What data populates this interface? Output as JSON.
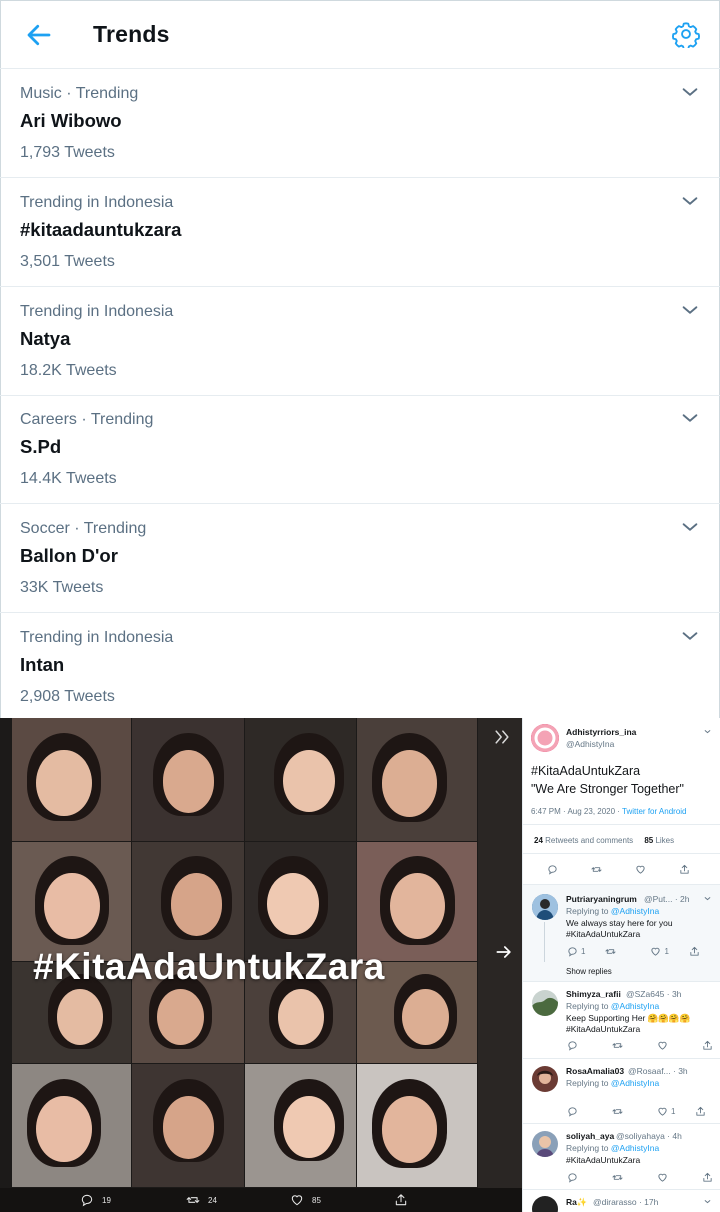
{
  "header": {
    "title": "Trends",
    "back_icon": "arrow-left-icon",
    "settings_icon": "gear-icon",
    "accent_color": "#1da1f2"
  },
  "trends": [
    {
      "context": "Music · Trending",
      "name": "Ari Wibowo",
      "count": "1,793 Tweets"
    },
    {
      "context": "Trending in Indonesia",
      "name": "#kitaadauntukzara",
      "count": "3,501 Tweets"
    },
    {
      "context": "Trending in Indonesia",
      "name": "Natya",
      "count": "18.2K Tweets"
    },
    {
      "context": "Careers · Trending",
      "name": "S.Pd",
      "count": "14.4K Tweets"
    },
    {
      "context": "Soccer · Trending",
      "name": "Ballon D'or",
      "count": "33K Tweets"
    },
    {
      "context": "Trending in Indonesia",
      "name": "Intan",
      "count": "2,908 Tweets"
    }
  ],
  "embed": {
    "media": {
      "overlay_text": "#KitaAdaUntukZara",
      "replies": "19",
      "retweets": "24",
      "likes": "85"
    },
    "tweet": {
      "author_name": "Adhistyrriors_ina",
      "author_handle": "@AdhistyIna",
      "hashtag": "#KitaAdaUntukZara",
      "text": "\"We Are Stronger Together\"",
      "time": "6:47 PM · Aug 23, 2020 · ",
      "source": "Twitter for Android",
      "retweets_count": "24",
      "retweets_label": "Retweets and comments",
      "likes_count": "85",
      "likes_label": "Likes"
    },
    "replies": [
      {
        "name": "Putriaryaningrum",
        "handle": "@Put... · 2h",
        "replying_prefix": "Replying to ",
        "replying_to": "@AdhistyIna",
        "line1": "We always stay here for you",
        "line2": "#KitaAdaUntukZara",
        "reply_count": "1",
        "like_count": "1",
        "show_replies": "Show replies"
      },
      {
        "name": "Shimyza_rafii",
        "handle": "@SZa645 · 3h",
        "replying_prefix": "Replying to ",
        "replying_to": "@AdhistyIna",
        "line1": "Keep Supporting Her 🤗🤗🤗🤗",
        "line2": "#KitaAdaUntukZara"
      },
      {
        "name": "RosaAmalia03",
        "handle": "@Rosaaf... · 3h",
        "replying_prefix": "Replying to ",
        "replying_to": "@AdhistyIna",
        "like_count": "1"
      },
      {
        "name": "soliyah_aya",
        "handle": "@soliyahaya · 4h",
        "replying_prefix": "Replying to ",
        "replying_to": "@AdhistyIna",
        "line2": "#KitaAdaUntukZara"
      },
      {
        "name": "Ra✨",
        "handle": "@dirarasso · 17h"
      }
    ]
  }
}
